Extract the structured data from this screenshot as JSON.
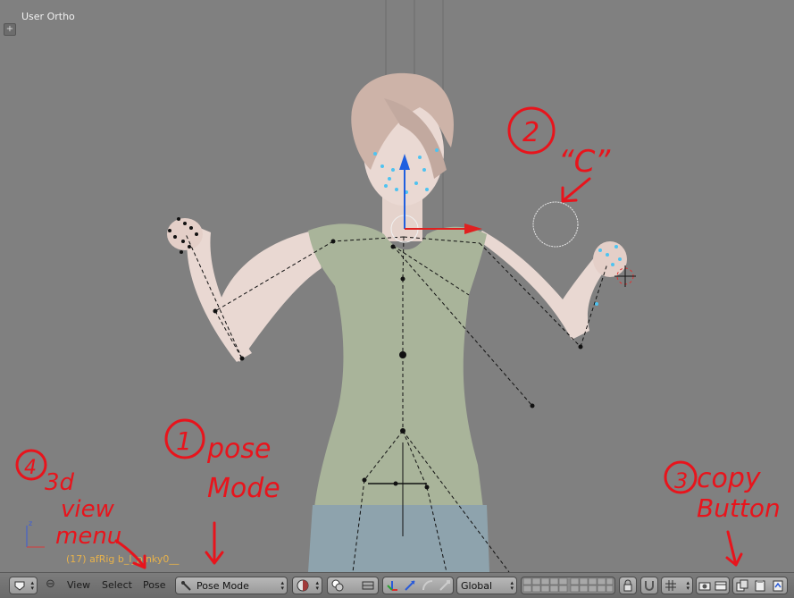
{
  "viewport": {
    "view_label": "User Ortho",
    "object_info": "(17) afRig b_l_pinky0__"
  },
  "header": {
    "editor_type_icon": "3d-view-icon",
    "menus": [
      "View",
      "Select",
      "Pose"
    ],
    "mode": "Pose Mode",
    "orientation": "Global"
  },
  "annotations": {
    "n1": "1",
    "pose_mode": "pose mode",
    "n2": "2",
    "c": "“C”",
    "n3": "3",
    "copy_button": "copy Button",
    "n4": "4",
    "view_menu": "3d view menu"
  },
  "colors": {
    "annotation": "#e8141c",
    "viewport_bg": "#808080",
    "mode_text": "#111111"
  }
}
